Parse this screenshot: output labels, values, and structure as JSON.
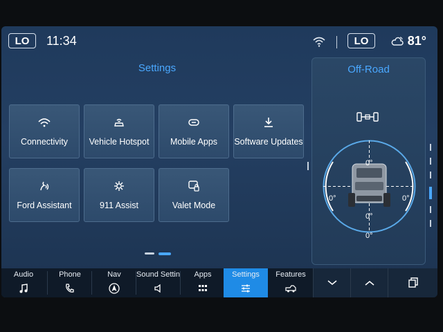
{
  "topbar": {
    "left_button": "LO",
    "time": "11:34",
    "right_button": "LO",
    "temperature": "81°"
  },
  "settings": {
    "title": "Settings",
    "tiles": [
      {
        "label": "Connectivity",
        "icon": "wifi-icon"
      },
      {
        "label": "Vehicle Hotspot",
        "icon": "car-hotspot-icon"
      },
      {
        "label": "Mobile Apps",
        "icon": "link-icon"
      },
      {
        "label": "Software Updates",
        "icon": "download-icon"
      },
      {
        "label": "Ford Assistant",
        "icon": "assistant-icon"
      },
      {
        "label": "911 Assist",
        "icon": "sos-icon"
      },
      {
        "label": "Valet Mode",
        "icon": "valet-icon"
      }
    ],
    "page_count": 2,
    "current_page": 2
  },
  "offroad": {
    "title": "Off-Road",
    "top_angle": "0°",
    "left_angle": "0°",
    "right_angle": "0°",
    "bottom_angle": "0°",
    "inner_angle": "0°"
  },
  "dock": {
    "items": [
      {
        "label": "Audio",
        "icon": "music-note-icon"
      },
      {
        "label": "Phone",
        "icon": "phone-icon"
      },
      {
        "label": "Nav",
        "icon": "navigation-icon"
      },
      {
        "label": "Sound Setting",
        "icon": "speaker-icon"
      },
      {
        "label": "Apps",
        "icon": "apps-grid-icon"
      },
      {
        "label": "Settings",
        "icon": "sliders-icon"
      },
      {
        "label": "Features",
        "icon": "truck-icon"
      }
    ],
    "active": "Settings",
    "accent": "#1f8be6"
  },
  "colors": {
    "title_blue": "#4aa8ff",
    "tile_bg": "#33506f"
  }
}
